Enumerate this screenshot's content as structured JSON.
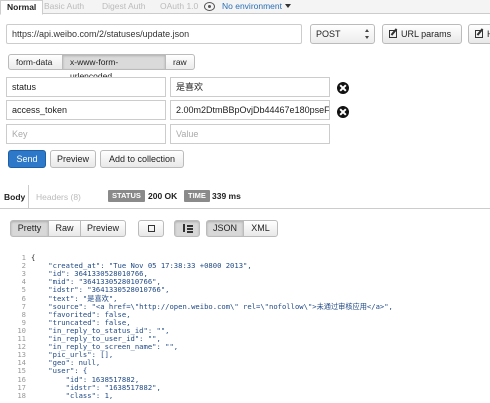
{
  "auth_tabs": [
    {
      "label": "Normal"
    },
    {
      "label": "Basic Auth"
    },
    {
      "label": "Digest Auth"
    },
    {
      "label": "OAuth 1.0"
    }
  ],
  "environment": {
    "label": "No environment"
  },
  "request": {
    "url": "https://api.weibo.com/2/statuses/update.json",
    "method": "POST",
    "url_params_label": "URL params",
    "headers_label": "H"
  },
  "body_types": [
    {
      "label": "form-data"
    },
    {
      "label": "x-www-form-urlencoded"
    },
    {
      "label": "raw"
    }
  ],
  "params": [
    {
      "key": "status",
      "value": "是喜欢"
    },
    {
      "key": "access_token",
      "value": "2.00m2DtmBBpOvjDb44467e180pseF"
    }
  ],
  "param_placeholder": {
    "key": "Key",
    "value": "Value"
  },
  "actions": {
    "send": "Send",
    "preview": "Preview",
    "add_to_collection": "Add to collection"
  },
  "response": {
    "body_tab": "Body",
    "headers_tab": "Headers (8)",
    "status_label": "STATUS",
    "status_value": "200 OK",
    "time_label": "TIME",
    "time_value": "339 ms"
  },
  "view_modes": {
    "pretty": "Pretty",
    "raw": "Raw",
    "preview": "Preview",
    "json": "JSON",
    "xml": "XML"
  },
  "code_lines": [
    {
      "n": "1",
      "t": "{"
    },
    {
      "n": "2",
      "t": "    \"created_at\": \"Tue Nov 05 17:38:33 +0800 2013\","
    },
    {
      "n": "3",
      "t": "    \"id\": 3641330528010766,"
    },
    {
      "n": "4",
      "t": "    \"mid\": \"3641330528010766\","
    },
    {
      "n": "5",
      "t": "    \"idstr\": \"3641330528010766\","
    },
    {
      "n": "6",
      "t": "    \"text\": \"是喜欢\","
    },
    {
      "n": "7",
      "t": "    \"source\": \"<a href=\\\"http://open.weibo.com\\\" rel=\\\"nofollow\\\">未通过审核应用</a>\","
    },
    {
      "n": "8",
      "t": "    \"favorited\": false,"
    },
    {
      "n": "9",
      "t": "    \"truncated\": false,"
    },
    {
      "n": "10",
      "t": "    \"in_reply_to_status_id\": \"\","
    },
    {
      "n": "11",
      "t": "    \"in_reply_to_user_id\": \"\","
    },
    {
      "n": "12",
      "t": "    \"in_reply_to_screen_name\": \"\","
    },
    {
      "n": "13",
      "t": "    \"pic_urls\": [],"
    },
    {
      "n": "14",
      "t": "    \"geo\": null,"
    },
    {
      "n": "15",
      "t": "    \"user\": {"
    },
    {
      "n": "16",
      "t": "        \"id\": 1638517882,"
    },
    {
      "n": "17",
      "t": "        \"idstr\": \"1638517882\","
    },
    {
      "n": "18",
      "t": "        \"class\": 1,"
    }
  ],
  "colors": {
    "accent": "#2d78c8",
    "link": "#2a6fb7",
    "badge": "#8a8a8a"
  }
}
